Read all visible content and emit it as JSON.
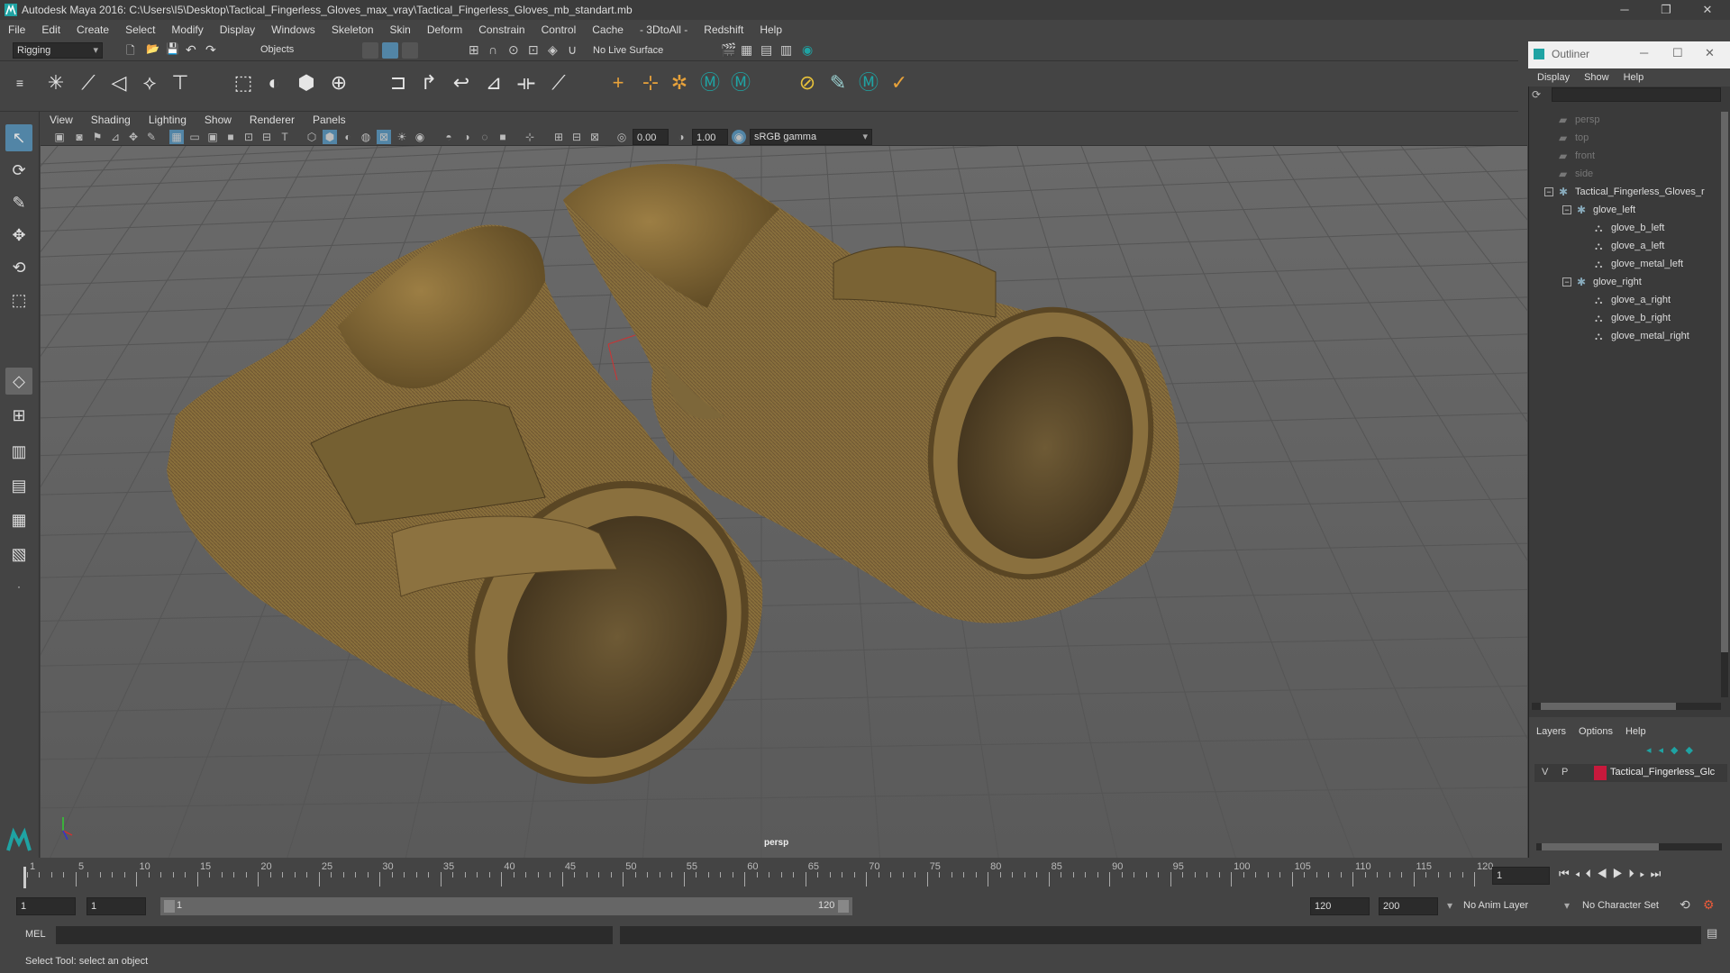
{
  "window": {
    "title": "Autodesk Maya 2016: C:\\Users\\I5\\Desktop\\Tactical_Fingerless_Gloves_max_vray\\Tactical_Fingerless_Gloves_mb_standart.mb",
    "minimize": "─",
    "maximize": "❐",
    "close": "✕"
  },
  "menubar": [
    "File",
    "Edit",
    "Create",
    "Select",
    "Modify",
    "Display",
    "Windows",
    "Skeleton",
    "Skin",
    "Deform",
    "Constrain",
    "Control",
    "Cache",
    "- 3DtoAll -",
    "Redshift",
    "Help"
  ],
  "statusline": {
    "mode": "Rigging",
    "select_mode": "Objects",
    "live_surface": "No Live Surface"
  },
  "viewport": {
    "menus": [
      "View",
      "Shading",
      "Lighting",
      "Show",
      "Renderer",
      "Panels"
    ],
    "exposure": "0.00",
    "gamma": "1.00",
    "color_space": "sRGB gamma",
    "camera_label": "persp"
  },
  "outliner": {
    "title": "Outliner",
    "menus": [
      "Display",
      "Show",
      "Help"
    ],
    "items": [
      {
        "label": "persp",
        "depth": 0,
        "dim": true
      },
      {
        "label": "top",
        "depth": 0,
        "dim": true
      },
      {
        "label": "front",
        "depth": 0,
        "dim": true
      },
      {
        "label": "side",
        "depth": 0,
        "dim": true
      },
      {
        "label": "Tactical_Fingerless_Gloves_r",
        "depth": 0,
        "dim": false
      },
      {
        "label": "glove_left",
        "depth": 1,
        "dim": false
      },
      {
        "label": "glove_b_left",
        "depth": 2,
        "dim": false
      },
      {
        "label": "glove_a_left",
        "depth": 2,
        "dim": false
      },
      {
        "label": "glove_metal_left",
        "depth": 2,
        "dim": false
      },
      {
        "label": "glove_right",
        "depth": 1,
        "dim": false
      },
      {
        "label": "glove_a_right",
        "depth": 2,
        "dim": false
      },
      {
        "label": "glove_b_right",
        "depth": 2,
        "dim": false
      },
      {
        "label": "glove_metal_right",
        "depth": 2,
        "dim": false
      }
    ]
  },
  "layers": {
    "menus": [
      "Layers",
      "Options",
      "Help"
    ],
    "row": {
      "v": "V",
      "p": "P",
      "name": "Tactical_Fingerless_Glc",
      "color": "#c8193c"
    }
  },
  "timeline": {
    "ticks": [
      "1",
      "5",
      "10",
      "15",
      "20",
      "25",
      "30",
      "35",
      "40",
      "45",
      "50",
      "55",
      "60",
      "65",
      "70",
      "75",
      "80",
      "85",
      "90",
      "95",
      "100",
      "105",
      "110",
      "115",
      "120"
    ],
    "current_frame": "1"
  },
  "range": {
    "start": "1",
    "playback_start": "1",
    "slider_start": "1",
    "slider_end": "120",
    "playback_end": "120",
    "end": "200",
    "anim_layer": "No Anim Layer",
    "character_set": "No Character Set"
  },
  "cmdline": {
    "label": "MEL"
  },
  "helpline": {
    "text": "Select Tool: select an object"
  }
}
